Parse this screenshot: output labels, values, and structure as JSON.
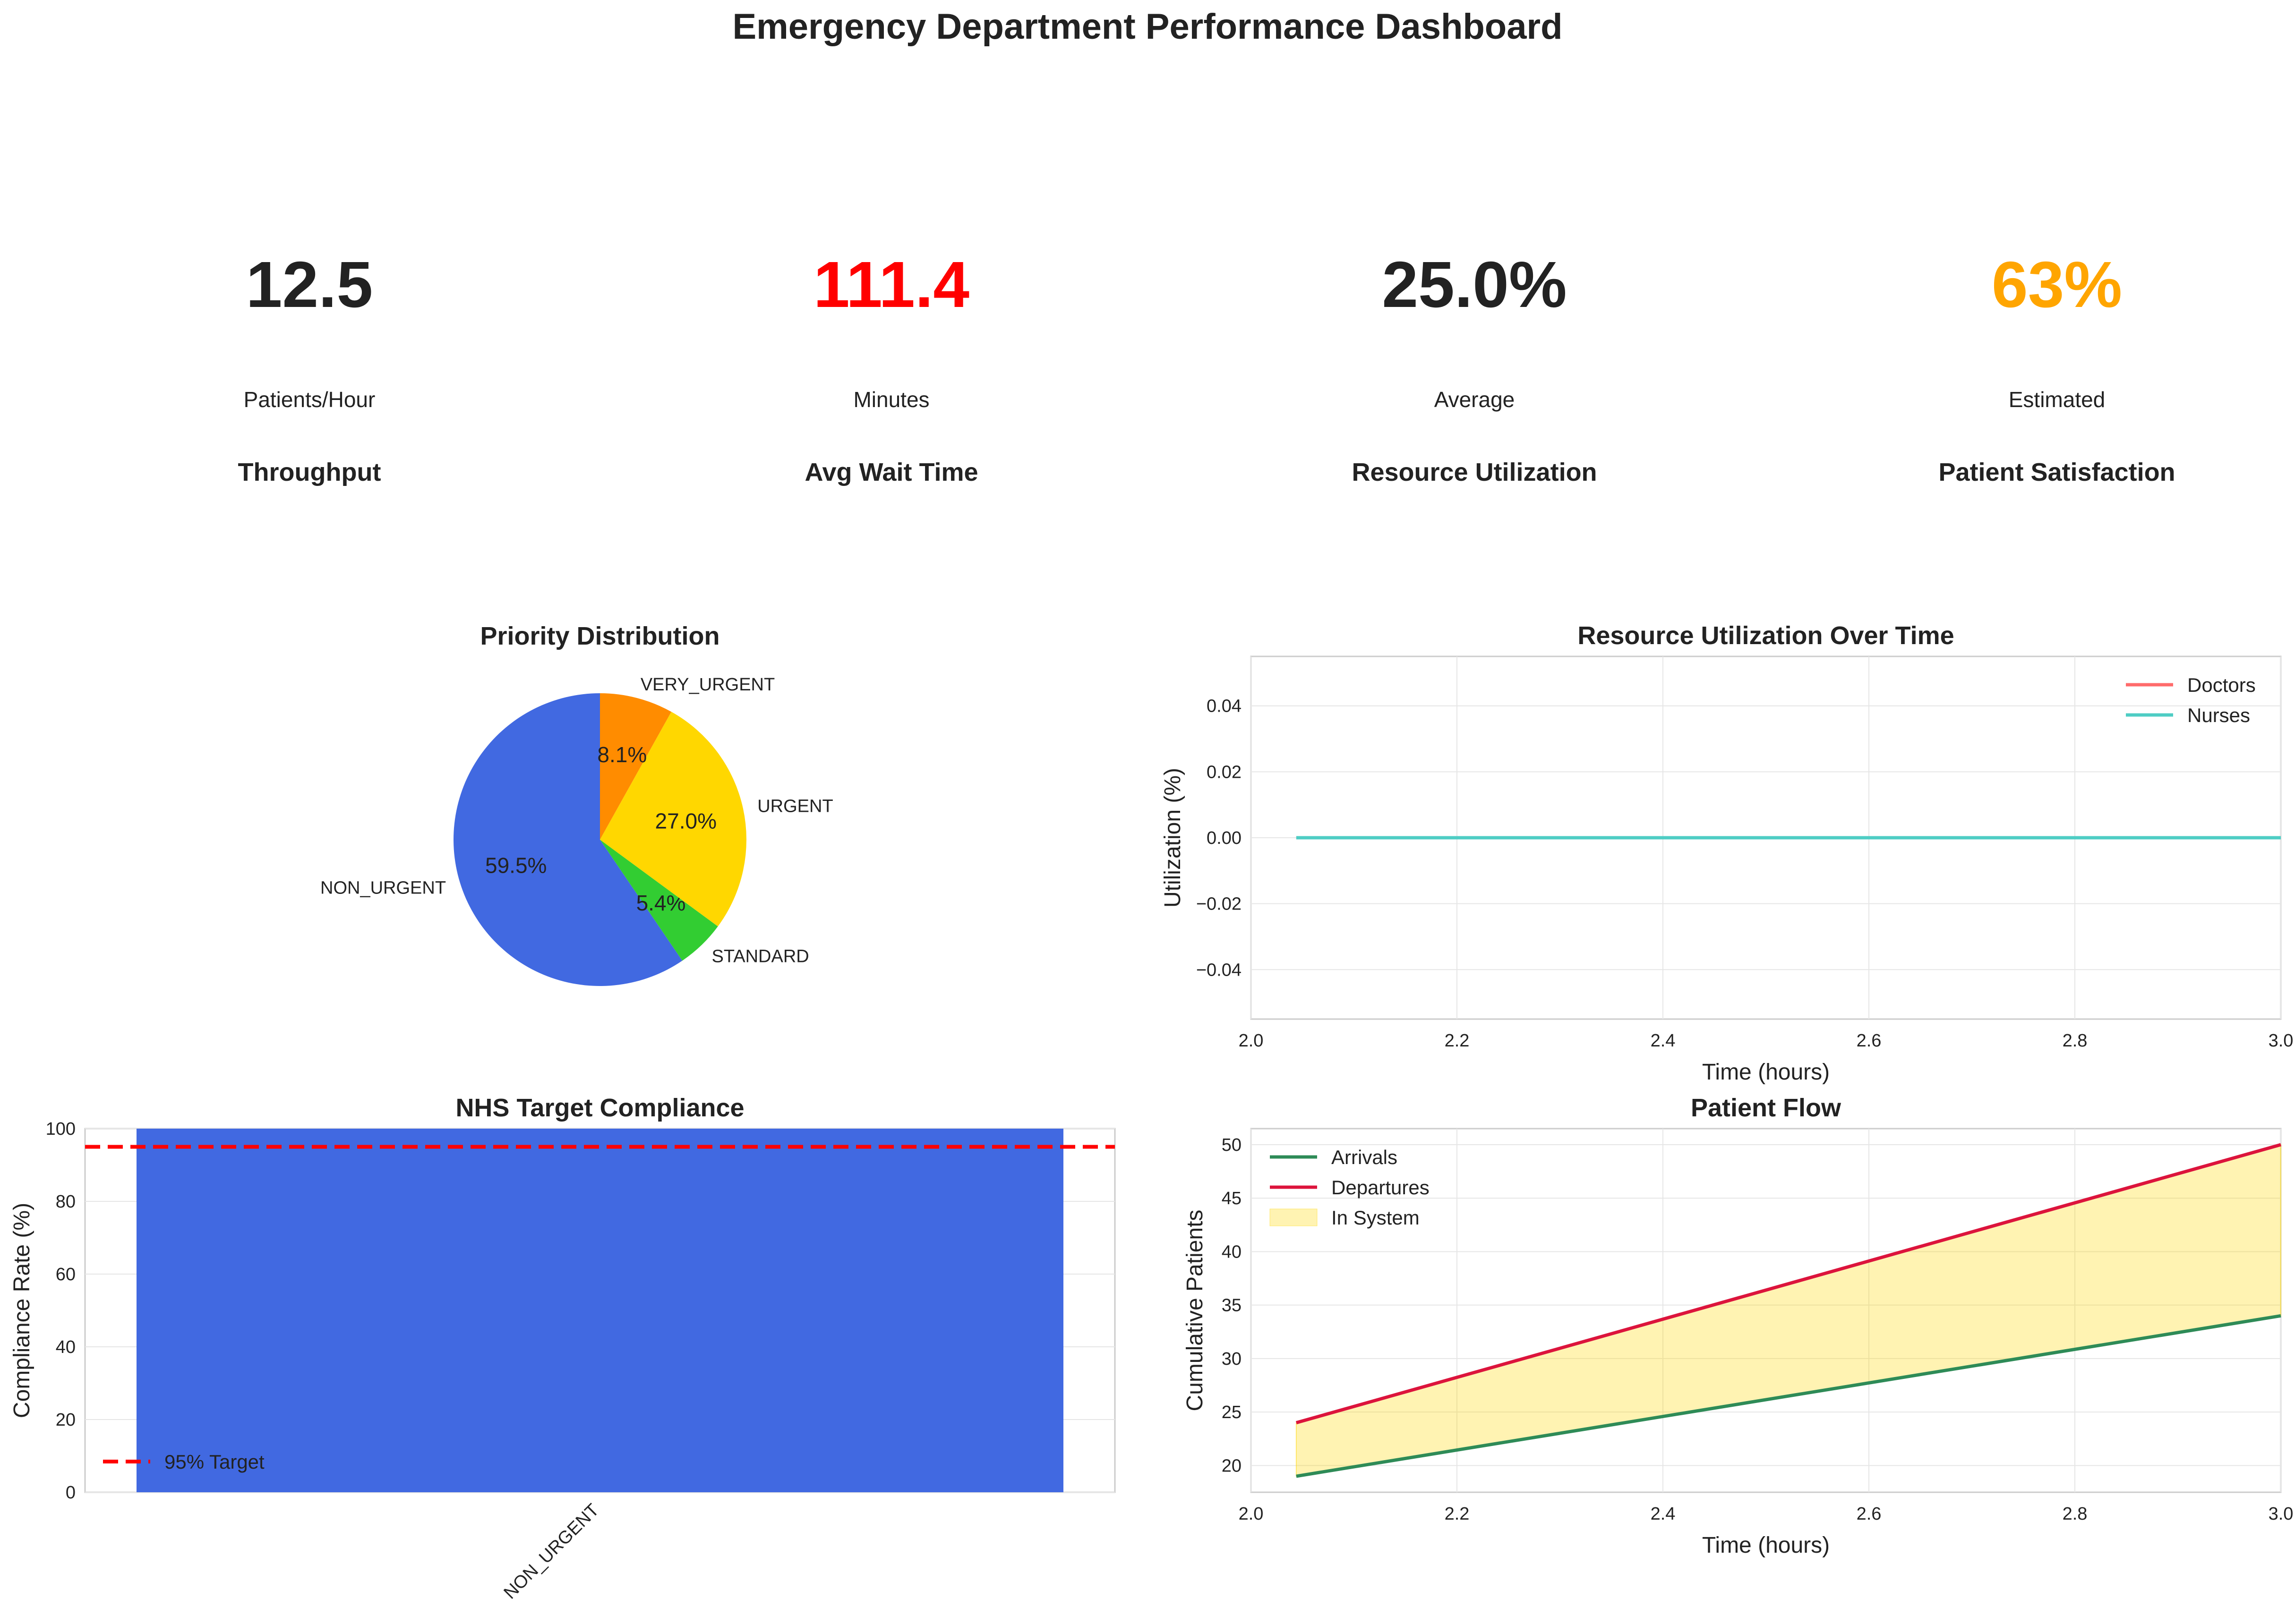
{
  "title": "Emergency Department Performance Dashboard",
  "kpis": [
    {
      "value": "12.5",
      "unit": "Patients/Hour",
      "label": "Throughput",
      "color": "#222222"
    },
    {
      "value": "111.4",
      "unit": "Minutes",
      "label": "Avg Wait Time",
      "color": "#ff0000"
    },
    {
      "value": "25.0%",
      "unit": "Average",
      "label": "Resource Utilization",
      "color": "#222222"
    },
    {
      "value": "63%",
      "unit": "Estimated",
      "label": "Patient Satisfaction",
      "color": "#ffa500"
    }
  ],
  "chart_data": [
    {
      "id": "priority",
      "type": "pie",
      "title": "Priority Distribution",
      "slices": [
        {
          "label": "NON_URGENT",
          "value": 59.5,
          "pct": "59.5%",
          "color": "#4169e1"
        },
        {
          "label": "STANDARD",
          "value": 5.4,
          "pct": "5.4%",
          "color": "#32cd32"
        },
        {
          "label": "URGENT",
          "value": 27.0,
          "pct": "27.0%",
          "color": "#ffd700"
        },
        {
          "label": "VERY_URGENT",
          "value": 8.1,
          "pct": "8.1%",
          "color": "#ff8c00"
        }
      ]
    },
    {
      "id": "utilization",
      "type": "line",
      "title": "Resource Utilization Over Time",
      "xlabel": "Time (hours)",
      "ylabel": "Utilization (%)",
      "xlim": [
        2.0,
        3.0
      ],
      "ylim": [
        -0.055,
        0.055
      ],
      "xticks": [
        "2.0",
        "2.2",
        "2.4",
        "2.6",
        "2.8",
        "3.0"
      ],
      "yticks": [
        "−0.04",
        "−0.02",
        "0.00",
        "0.02",
        "0.04"
      ],
      "grid": true,
      "legend": "top-right",
      "series": [
        {
          "name": "Doctors",
          "color": "#ff6b6b",
          "x": [
            2.044,
            3.0
          ],
          "y": [
            0,
            0
          ]
        },
        {
          "name": "Nurses",
          "color": "#4ecdc4",
          "x": [
            2.044,
            3.0
          ],
          "y": [
            0,
            0
          ]
        }
      ]
    },
    {
      "id": "compliance",
      "type": "bar",
      "title": "NHS Target Compliance",
      "ylabel": "Compliance Rate (%)",
      "categories": [
        "NON_URGENT"
      ],
      "values": [
        100
      ],
      "bar_color": "#4169e1",
      "ylim": [
        0,
        100
      ],
      "yticks": [
        "0",
        "20",
        "40",
        "60",
        "80",
        "100"
      ],
      "target": {
        "value": 95,
        "label": "95% Target",
        "color": "#ff0000"
      },
      "grid": true,
      "legend": "bottom-left"
    },
    {
      "id": "flow",
      "type": "area",
      "title": "Patient Flow",
      "xlabel": "Time (hours)",
      "ylabel": "Cumulative Patients",
      "xlim": [
        2.0,
        3.0
      ],
      "ylim": [
        17.5,
        51.5
      ],
      "xticks": [
        "2.0",
        "2.2",
        "2.4",
        "2.6",
        "2.8",
        "3.0"
      ],
      "yticks": [
        "20",
        "25",
        "30",
        "35",
        "40",
        "45",
        "50"
      ],
      "grid": true,
      "legend": "top-left",
      "series": [
        {
          "name": "Arrivals",
          "color": "#2e8b57",
          "x": [
            2.044,
            3.0
          ],
          "y": [
            19,
            34
          ]
        },
        {
          "name": "Departures",
          "color": "#dc143c",
          "x": [
            2.044,
            3.0
          ],
          "y": [
            24,
            50
          ]
        }
      ],
      "fill": {
        "name": "In System",
        "color": "#ffd700"
      }
    }
  ]
}
